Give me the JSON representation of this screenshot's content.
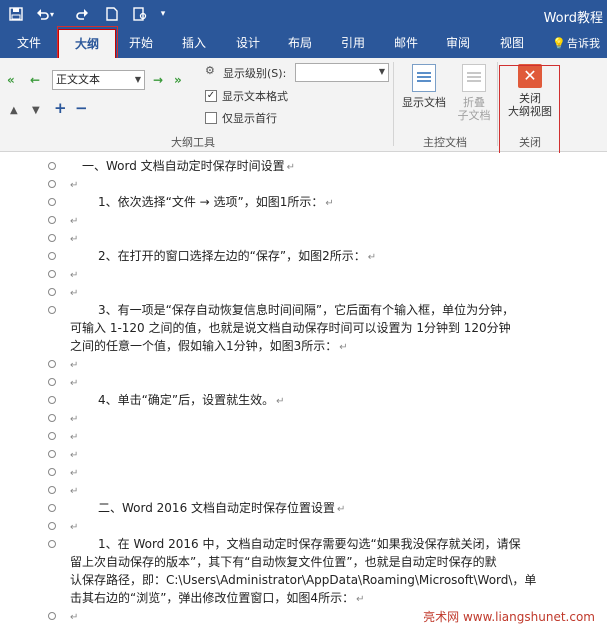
{
  "app": {
    "doc_title": "Word教程"
  },
  "quick_access": {
    "icons": [
      "save-icon",
      "undo-icon",
      "redo-icon",
      "new-doc-icon",
      "print-preview-icon",
      "customize-icon"
    ]
  },
  "tabs": [
    "文件",
    "大纲",
    "开始",
    "插入",
    "设计",
    "布局",
    "引用",
    "邮件",
    "审阅",
    "视图",
    "告诉我"
  ],
  "active_tab": "大纲",
  "ribbon": {
    "outline_tools": {
      "level_select_value": "正文文本",
      "show_level_label": "显示级别(S):",
      "show_level_value": "",
      "show_text_format_label": "显示文本格式",
      "show_text_format_checked": true,
      "show_first_line_only_label": "仅显示首行",
      "show_first_line_only_checked": false,
      "group_label": "大纲工具"
    },
    "master_document": {
      "show_document_label": "显示文档",
      "collapse_subdocs_label": [
        "折叠",
        "子文档"
      ],
      "group_label": "主控文档"
    },
    "close": {
      "close_outline_label": [
        "关闭",
        "大纲视图"
      ],
      "group_label": "关闭"
    }
  },
  "document": {
    "paragraph_mark": "↵",
    "paragraphs": [
      {
        "lines": [
          "一、Word 文档自动定时保存时间设置"
        ],
        "indent": 1
      },
      {
        "lines": [
          ""
        ],
        "indent": 0
      },
      {
        "lines": [
          "1、依次选择“文件 → 选项”，如图1所示："
        ],
        "indent": 2
      },
      {
        "lines": [
          ""
        ],
        "indent": 0
      },
      {
        "lines": [
          ""
        ],
        "indent": 0
      },
      {
        "lines": [
          "2、在打开的窗口选择左边的“保存”，如图2所示："
        ],
        "indent": 2
      },
      {
        "lines": [
          ""
        ],
        "indent": 0
      },
      {
        "lines": [
          ""
        ],
        "indent": 0
      },
      {
        "lines": [
          "3、有一项是“保存自动恢复信息时间间隔”，它后面有个输入框，单位为分钟，",
          "可输入 1-120 之间的值，也就是说文档自动保存时间可以设置为 1分钟到 120分钟",
          "之间的任意一个值，假如输入1分钟，如图3所示："
        ],
        "indent": 2
      },
      {
        "lines": [
          ""
        ],
        "indent": 0
      },
      {
        "lines": [
          ""
        ],
        "indent": 0
      },
      {
        "lines": [
          "4、单击“确定”后，设置就生效。"
        ],
        "indent": 2
      },
      {
        "lines": [
          ""
        ],
        "indent": 0
      },
      {
        "lines": [
          ""
        ],
        "indent": 0
      },
      {
        "lines": [
          ""
        ],
        "indent": 0
      },
      {
        "lines": [
          ""
        ],
        "indent": 0
      },
      {
        "lines": [
          ""
        ],
        "indent": 0
      },
      {
        "lines": [
          "二、Word 2016 文档自动定时保存位置设置"
        ],
        "indent": 2
      },
      {
        "lines": [
          ""
        ],
        "indent": 0
      },
      {
        "lines": [
          "1、在 Word 2016 中，文档自动定时保存需要勾选“如果我没保存就关闭，请保",
          "留上次自动保存的版本”，其下有“自动恢复文件位置”，也就是自动定时保存的默",
          "认保存路径，即：C:\\Users\\Administrator\\AppData\\Roaming\\Microsoft\\Word\\，单",
          "击其右边的“浏览”，弹出修改位置窗口，如图4所示："
        ],
        "indent": 2
      },
      {
        "lines": [
          ""
        ],
        "indent": 0
      }
    ]
  },
  "watermark": "亮术网 www.liangshunet.com"
}
